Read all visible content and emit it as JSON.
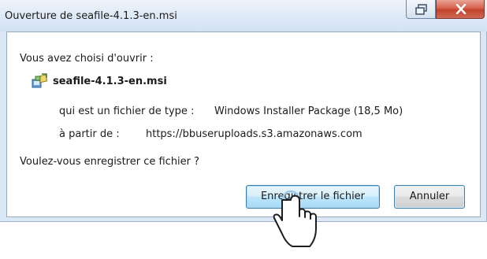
{
  "window": {
    "title": "Ouverture de seafile-4.1.3-en.msi"
  },
  "dialog": {
    "intro": "Vous avez choisi d'ouvrir :",
    "file_name": "seafile-4.1.3-en.msi",
    "type_label": "qui est un fichier de type :",
    "type_value": "Windows Installer Package (18,5 Mo)",
    "from_label": "à partir de :",
    "from_value": "https://bbuseruploads.s3.amazonaws.com",
    "question": "Voulez-vous enregistrer ce fichier ?",
    "save_button": "Enregistrer le fichier",
    "cancel_button": "Annuler"
  },
  "icons": {
    "file": "msi-installer-icon",
    "restore": "restore-icon",
    "close": "close-icon",
    "cursor": "hand-pointer-icon"
  }
}
